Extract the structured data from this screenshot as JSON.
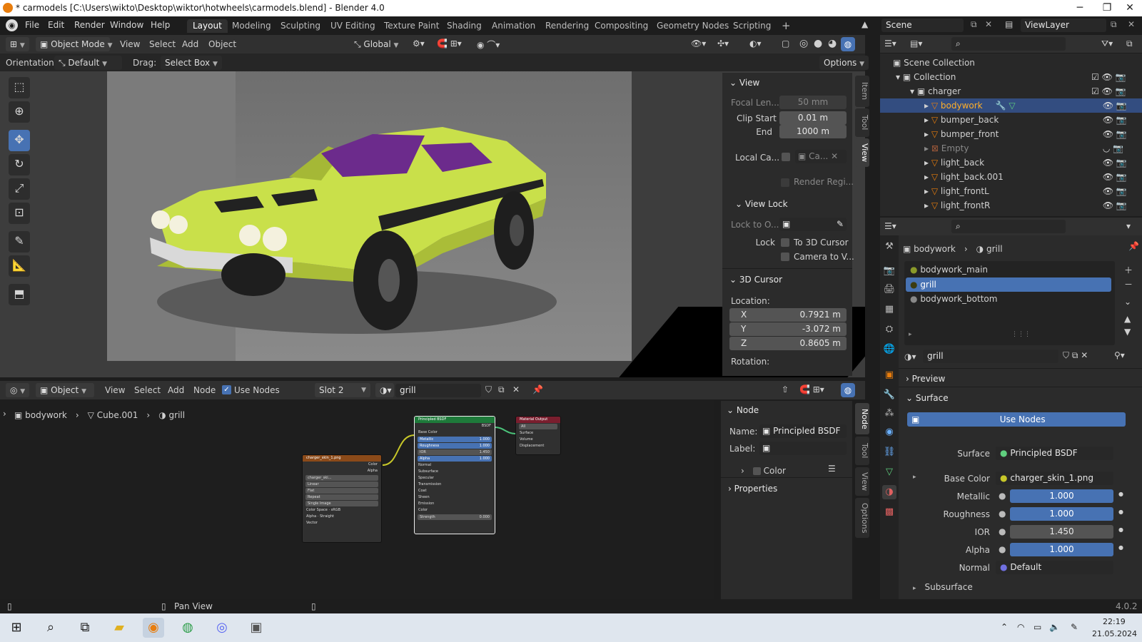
{
  "window": {
    "title": "* carmodels [C:\\Users\\wikto\\Desktop\\wiktor\\hotwheels\\carmodels.blend] - Blender 4.0"
  },
  "menu": {
    "file": "File",
    "edit": "Edit",
    "render": "Render",
    "window": "Window",
    "help": "Help"
  },
  "workspaces": [
    "Layout",
    "Modeling",
    "Sculpting",
    "UV Editing",
    "Texture Paint",
    "Shading",
    "Animation",
    "Rendering",
    "Compositing",
    "Geometry Nodes",
    "Scripting"
  ],
  "scene": {
    "name": "Scene",
    "view_layer": "ViewLayer"
  },
  "viewport_header": {
    "mode": "Object Mode",
    "view": "View",
    "select": "Select",
    "add": "Add",
    "object": "Object",
    "transform": "Global"
  },
  "tool_header": {
    "orientation_label": "Orientation:",
    "orientation": "Default",
    "drag_label": "Drag:",
    "drag": "Select Box",
    "options": "Options"
  },
  "npanel": {
    "tabs": [
      "Item",
      "Tool",
      "View"
    ],
    "view_title": "View",
    "focal_label": "Focal Len...",
    "focal_value": "50 mm",
    "clip_start_label": "Clip Start",
    "clip_start_value": "0.01 m",
    "end_label": "End",
    "end_value": "1000 m",
    "local_cam_label": "Local Ca...",
    "local_cam_value": "Ca...",
    "render_region": "Render Regi...",
    "view_lock_title": "View Lock",
    "lock_to_label": "Lock to O...",
    "lock_label": "Lock",
    "to_cursor": "To 3D Cursor",
    "camera_to_view": "Camera to V...",
    "cursor_title": "3D Cursor",
    "location_label": "Location:",
    "x_label": "X",
    "x_value": "0.7921 m",
    "y_label": "Y",
    "y_value": "-3.072 m",
    "z_label": "Z",
    "z_value": "0.8605 m",
    "rotation_label": "Rotation:"
  },
  "node_header": {
    "type": "Object",
    "view": "View",
    "select": "Select",
    "add": "Add",
    "node": "Node",
    "use_nodes": "Use Nodes",
    "slot": "Slot 2",
    "material": "grill"
  },
  "breadcrumb": {
    "object": "bodywork",
    "mesh": "Cube.001",
    "material": "grill"
  },
  "nodes": {
    "image": {
      "title": "charger_skin_1.png",
      "color": "Color",
      "alpha": "Alpha",
      "file": "charger_ski...",
      "interp": "Linear",
      "proj": "Flat",
      "ext": "Repeat",
      "src": "Single Image",
      "cs_label": "Color Space",
      "cs": "sRGB",
      "alpha_label": "Alpha",
      "alpha_mode": "Straight",
      "vector": "Vector"
    },
    "bsdf": {
      "title": "Principled BSDF",
      "out": "BSDF",
      "base_color": "Base Color",
      "metallic": "Metallic",
      "metallic_v": "1.000",
      "roughness": "Roughness",
      "roughness_v": "1.000",
      "ior": "IOR",
      "ior_v": "1.450",
      "alpha": "Alpha",
      "alpha_v": "1.000",
      "normal": "Normal",
      "subsurface": "Subsurface",
      "specular": "Specular",
      "transmission": "Transmission",
      "coat": "Coat",
      "sheen": "Sheen",
      "emission": "Emission",
      "color": "Color",
      "strength": "Strength",
      "strength_v": "0.000"
    },
    "output": {
      "title": "Material Output",
      "target": "All",
      "surface": "Surface",
      "volume": "Volume",
      "displacement": "Displacement"
    }
  },
  "node_npanel": {
    "tabs": [
      "Node",
      "Tool",
      "View",
      "Options"
    ],
    "title": "Node",
    "name_label": "Name:",
    "name_value": "Principled BSDF",
    "label_label": "Label:",
    "color": "Color",
    "properties": "Properties"
  },
  "outliner": {
    "root": "Scene Collection",
    "rows": [
      {
        "name": "Collection",
        "level": 1
      },
      {
        "name": "charger",
        "level": 2
      },
      {
        "name": "bodywork",
        "level": 3,
        "selected": true
      },
      {
        "name": "bumper_back",
        "level": 3
      },
      {
        "name": "bumper_front",
        "level": 3
      },
      {
        "name": "Empty",
        "level": 3,
        "dim": true
      },
      {
        "name": "light_back",
        "level": 3
      },
      {
        "name": "light_back.001",
        "level": 3
      },
      {
        "name": "light_frontL",
        "level": 3
      },
      {
        "name": "light_frontR",
        "level": 3
      }
    ]
  },
  "properties": {
    "breadcrumb_object": "bodywork",
    "breadcrumb_material": "grill",
    "slots": [
      "bodywork_main",
      "grill",
      "bodywork_bottom"
    ],
    "material_name": "grill",
    "preview": "Preview",
    "surface_panel": "Surface",
    "use_nodes": "Use Nodes",
    "surface_label": "Surface",
    "surface_value": "Principled BSDF",
    "base_color_label": "Base Color",
    "base_color_value": "charger_skin_1.png",
    "metallic_label": "Metallic",
    "metallic_value": "1.000",
    "roughness_label": "Roughness",
    "roughness_value": "1.000",
    "ior_label": "IOR",
    "ior_value": "1.450",
    "alpha_label": "Alpha",
    "alpha_value": "1.000",
    "normal_label": "Normal",
    "normal_value": "Default",
    "subsurface": "Subsurface"
  },
  "status": {
    "pan": "Pan View",
    "version": "4.0.2"
  },
  "taskbar": {
    "time": "22:19",
    "date": "21.05.2024"
  },
  "colors": {
    "accent": "#4772b3",
    "selected_row": "#334d80",
    "car_body": "#c9e04a",
    "orange_active": "#e87d0d"
  }
}
